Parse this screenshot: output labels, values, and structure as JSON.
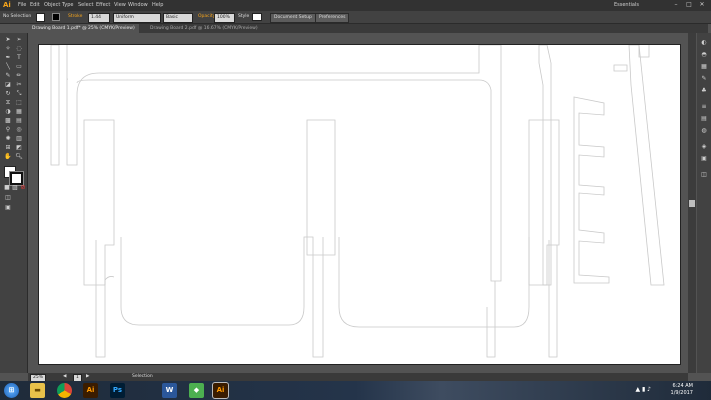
{
  "app": {
    "logo": "Ai"
  },
  "menu": [
    "File",
    "Edit",
    "Object",
    "Type",
    "Select",
    "Effect",
    "View",
    "Window",
    "Help"
  ],
  "workspace": "Essentials",
  "control_bar": {
    "selection": "No Selection",
    "stroke_label": "Stroke",
    "stroke_value": "1.44 pt",
    "brush": "Uniform",
    "brush2": "Basic",
    "opacity_label": "Opacity",
    "opacity_value": "100%",
    "style_label": "Style",
    "doc_setup": "Document Setup",
    "preferences": "Preferences"
  },
  "tabs": [
    {
      "label": "Drawing Board 1.pdf* @ 25% (CMYK/Preview)",
      "active": true
    },
    {
      "label": "Drawing Board 2.pdf @ 16.67% (CMYK/Preview)",
      "active": false
    }
  ],
  "status": {
    "zoom": "25%",
    "page": "1",
    "tool": "Selection"
  },
  "taskbar": {
    "time": "6:24 AM",
    "date": "1/9/2017",
    "apps": [
      "start",
      "explorer",
      "chrome",
      "illustrator",
      "photoshop",
      "word",
      "maps",
      "illustrator-active"
    ]
  },
  "colors": {
    "accent": "#f7a51b",
    "canvas": "#535353",
    "artboard": "#ffffff"
  }
}
